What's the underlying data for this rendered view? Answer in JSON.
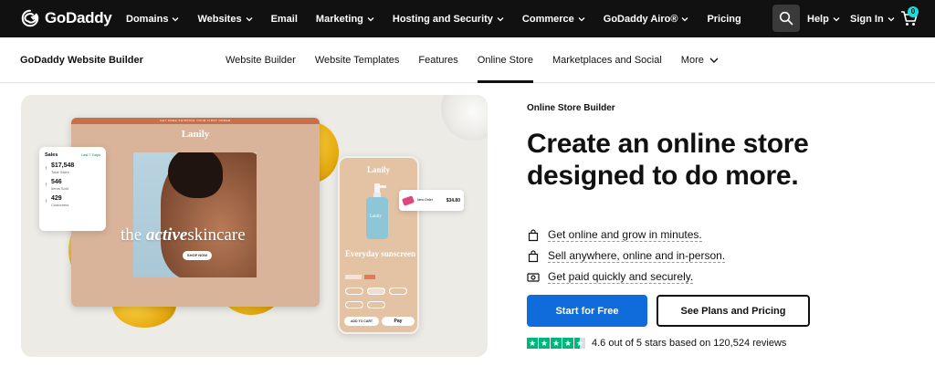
{
  "brand": {
    "name": "GoDaddy"
  },
  "topnav": {
    "items": [
      {
        "label": "Domains",
        "has_menu": true
      },
      {
        "label": "Websites",
        "has_menu": true
      },
      {
        "label": "Email",
        "has_menu": false
      },
      {
        "label": "Marketing",
        "has_menu": true
      },
      {
        "label": "Hosting and Security",
        "has_menu": true
      },
      {
        "label": "Commerce",
        "has_menu": true
      },
      {
        "label": "GoDaddy Airo®",
        "has_menu": true
      },
      {
        "label": "Pricing",
        "has_menu": false
      }
    ],
    "help_label": "Help",
    "signin_label": "Sign In",
    "cart_count": "0",
    "search_icon": "search-icon"
  },
  "subnav": {
    "title": "GoDaddy Website Builder",
    "items": [
      {
        "label": "Website Builder",
        "active": false
      },
      {
        "label": "Website Templates",
        "active": false
      },
      {
        "label": "Features",
        "active": false
      },
      {
        "label": "Online Store",
        "active": true
      },
      {
        "label": "Marketplaces and Social",
        "active": false
      },
      {
        "label": "More",
        "active": false
      }
    ]
  },
  "hero_image": {
    "promo_bar": "GET FREE SHIPPING YOUR FIRST ORDER",
    "store_brand": "Lanily",
    "overlay_prefix": "the ",
    "overlay_italic": "active",
    "overlay_suffix": "skincare",
    "shop_now": "SHOP NOW",
    "sales": {
      "title": "Sales",
      "period": "Last 7 Days",
      "rows": [
        {
          "value": "$17,548",
          "label": "Total Sales"
        },
        {
          "value": "546",
          "label": "Items Sold"
        },
        {
          "value": "429",
          "label": "Customers"
        }
      ]
    },
    "phone": {
      "brand": "Lanily",
      "bottle_label": "Lanily",
      "title": "Everyday sunscreen",
      "add_to_cart": "ADD TO CART",
      "pay": "Pay"
    },
    "order": {
      "label": "New Order",
      "price": "$34.80"
    }
  },
  "content": {
    "eyebrow": "Online Store Builder",
    "headline": "Create an online store designed to do more.",
    "bullets": [
      {
        "icon": "shopping-bag-icon",
        "text": "Get online and grow in minutes."
      },
      {
        "icon": "shopping-bag-icon",
        "text": "Sell anywhere, online and in-person."
      },
      {
        "icon": "cash-icon",
        "text": "Get paid quickly and securely."
      }
    ],
    "primary_cta": "Start for Free",
    "secondary_cta": "See Plans and Pricing",
    "rating": {
      "score": 4.6,
      "text": "4.6 out of 5 stars based on 120,524 reviews"
    }
  },
  "colors": {
    "topnav_bg": "#111111",
    "primary_button": "#0f6cda",
    "star_green": "#00b67a",
    "cart_badge": "#1bdbdb"
  }
}
